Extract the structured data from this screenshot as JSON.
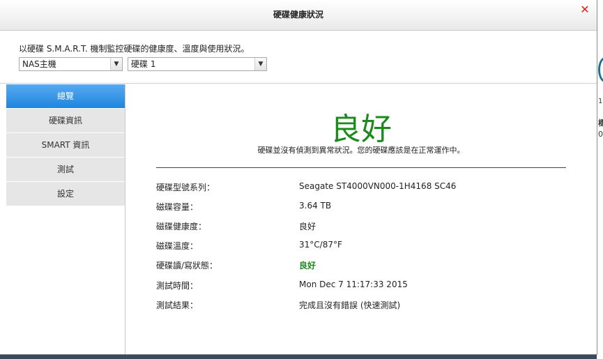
{
  "dialog": {
    "title": "硬碟健康狀況",
    "description": "以硬碟 S.M.A.R.T. 機制監控硬碟的健康度、溫度與使用狀況。",
    "host_select": {
      "value": "NAS主機"
    },
    "disk_select": {
      "value": "硬碟 1"
    }
  },
  "sidebar": {
    "items": [
      {
        "label": "總覽",
        "active": true
      },
      {
        "label": "硬碟資訊"
      },
      {
        "label": "SMART 資訊"
      },
      {
        "label": "測試"
      },
      {
        "label": "設定"
      }
    ]
  },
  "overview": {
    "status": "良好",
    "status_message": "硬碟並沒有偵測到異常狀況。您的硬碟應該是在正常運作中。",
    "status_color": "#1e8a1e",
    "rows": [
      {
        "label": "硬碟型號系列：",
        "value": "Seagate ST4000VN000-1H4168 SC46"
      },
      {
        "label": "磁碟容量：",
        "value": "3.64 TB"
      },
      {
        "label": "磁碟健康度：",
        "value": "良好"
      },
      {
        "label": "磁碟溫度：",
        "value": "31°C/87°F"
      },
      {
        "label": "硬碟讀/寫狀態：",
        "value": "良好"
      },
      {
        "label": "測試時間：",
        "value": "Mon Dec 7 11:17:33 2015"
      },
      {
        "label": "測試結果：",
        "value": "完成且沒有錯誤 (快速測試)"
      }
    ]
  },
  "background": {
    "text_1": "1",
    "text_2": "標",
    "text_3": "0"
  }
}
